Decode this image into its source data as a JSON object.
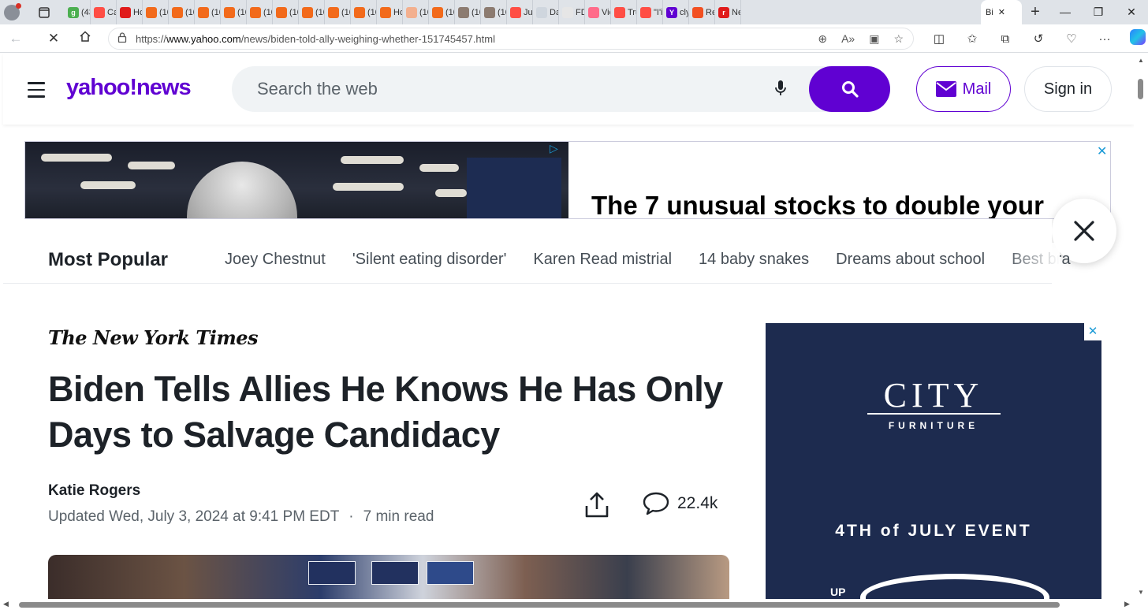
{
  "browser": {
    "tabs": [
      {
        "label": "(43",
        "fav": "#4caf50",
        "glyph": "g"
      },
      {
        "label": "Ca",
        "fav": "#ff4e45",
        "glyph": ""
      },
      {
        "label": "Hc",
        "fav": "#e01b1b",
        "glyph": ""
      },
      {
        "label": "(10",
        "fav": "#f26a1b",
        "glyph": ""
      },
      {
        "label": "(10",
        "fav": "#f26a1b",
        "glyph": ""
      },
      {
        "label": "(10",
        "fav": "#f26a1b",
        "glyph": ""
      },
      {
        "label": "(10",
        "fav": "#f26a1b",
        "glyph": ""
      },
      {
        "label": "(10",
        "fav": "#f26a1b",
        "glyph": ""
      },
      {
        "label": "(10",
        "fav": "#f26a1b",
        "glyph": ""
      },
      {
        "label": "(10",
        "fav": "#f26a1b",
        "glyph": ""
      },
      {
        "label": "(10",
        "fav": "#f26a1b",
        "glyph": ""
      },
      {
        "label": "(10",
        "fav": "#f26a1b",
        "glyph": ""
      },
      {
        "label": "Hc",
        "fav": "#f26a1b",
        "glyph": ""
      },
      {
        "label": "(10",
        "fav": "#f3b08f",
        "glyph": ""
      },
      {
        "label": "(10",
        "fav": "#f26a1b",
        "glyph": ""
      },
      {
        "label": "(10",
        "fav": "#8c7b70",
        "glyph": ""
      },
      {
        "label": "(10",
        "fav": "#8c7b70",
        "glyph": ""
      },
      {
        "label": "Jul",
        "fav": "#ff4e45",
        "glyph": ""
      },
      {
        "label": "Da",
        "fav": "#cfd6de",
        "glyph": ""
      },
      {
        "label": "FD",
        "fav": "#e6e6e6",
        "glyph": ""
      },
      {
        "label": "Vic",
        "fav": "#ff6b8a",
        "glyph": ""
      },
      {
        "label": "Tru",
        "fav": "#ff4e45",
        "glyph": ""
      },
      {
        "label": "\"I'i",
        "fav": "#ff4e45",
        "glyph": ""
      },
      {
        "label": "cly",
        "fav": "#6001d2",
        "glyph": "Y"
      },
      {
        "label": "Re",
        "fav": "#f25022",
        "glyph": ""
      },
      {
        "label": "Ne",
        "fav": "#e01b1b",
        "glyph": "r"
      }
    ],
    "active_tab_label": "Bi",
    "url_prefix": "https://",
    "url_domain": "www.yahoo.com",
    "url_path": "/news/biden-told-ally-weighing-whether-151745457.html"
  },
  "header": {
    "logo_text": "yahoo!news",
    "search_placeholder": "Search the web",
    "mail_label": "Mail",
    "signin_label": "Sign in",
    "brand_color": "#6001d2"
  },
  "ad_banner": {
    "headline": "The 7 unusual stocks to double your"
  },
  "most_popular": {
    "title": "Most Popular",
    "items": [
      "Joey Chestnut",
      "'Silent eating disorder'",
      "Karen Read mistrial",
      "14 baby snakes",
      "Dreams about school",
      "Best bra"
    ]
  },
  "article": {
    "source": "The New York Times",
    "headline": "Biden Tells Allies He Knows He Has Only Days to Salvage Candidacy",
    "author": "Katie Rogers",
    "updated": "Updated Wed, July 3, 2024 at 9:41 PM EDT",
    "separator": "·",
    "read_time": "7 min read",
    "comment_count": "22.4k"
  },
  "side_ad": {
    "brand": "CITY",
    "sub": "FURNITURE",
    "event": "4TH of JULY EVENT",
    "up_to": "UP"
  }
}
